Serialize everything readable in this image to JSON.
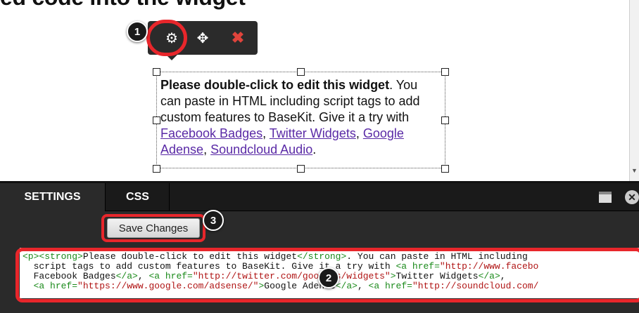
{
  "heading": "ed code into the widget",
  "toolbar": {
    "gear_icon": "gear-icon",
    "move_icon": "move-icon",
    "close_icon": "close-icon"
  },
  "callouts": [
    "1",
    "2",
    "3"
  ],
  "widget": {
    "lead_bold": "Please double-click to edit this widget",
    "lead_end": ".",
    "body": "You can paste in HTML including script tags to add custom features to BaseKit. Give it a try with",
    "links": [
      "Facebook Badges",
      "Twitter Widgets",
      "Google Adense",
      "Soundcloud Audio"
    ],
    "sep": ", ",
    "end": "."
  },
  "panel": {
    "tabs": [
      "SETTINGS",
      "CSS"
    ],
    "save_label": "Save Changes",
    "code_lines": [
      [
        [
          "t",
          "<p><strong>"
        ],
        [
          "x",
          "Please double-click to edit this widget"
        ],
        [
          "t",
          "</strong>"
        ],
        [
          "x",
          ". You can paste in HTML including"
        ]
      ],
      [
        [
          "x",
          "  script tags to add custom features to BaseKit. Give it a try with "
        ],
        [
          "t",
          "<a href="
        ],
        [
          "s",
          "\"http://www.facebo"
        ]
      ],
      [
        [
          "x",
          "  Facebook Badges"
        ],
        [
          "t",
          "</a>"
        ],
        [
          "x",
          ", "
        ],
        [
          "t",
          "<a href="
        ],
        [
          "s",
          "\"http://twitter.com/goodies/widgets\""
        ],
        [
          "t",
          ">"
        ],
        [
          "x",
          "Twitter Widgets"
        ],
        [
          "t",
          "</a>"
        ],
        [
          "x",
          ","
        ]
      ],
      [
        [
          "x",
          "  "
        ],
        [
          "t",
          "<a href="
        ],
        [
          "s",
          "\"https://www.google.com/adsense/\""
        ],
        [
          "t",
          ">"
        ],
        [
          "x",
          "Google Adense"
        ],
        [
          "t",
          "</a>"
        ],
        [
          "x",
          ", "
        ],
        [
          "t",
          "<a href="
        ],
        [
          "s",
          "\"http://soundcloud.com/"
        ]
      ]
    ]
  },
  "colors": {
    "callout_ring": "#e8262b",
    "toolbar_bg": "#2b2b2b",
    "panel_bg": "#2a2a2a",
    "link": "#5a2aa6",
    "code_tag": "#1a8a1a",
    "code_string": "#b01414"
  }
}
